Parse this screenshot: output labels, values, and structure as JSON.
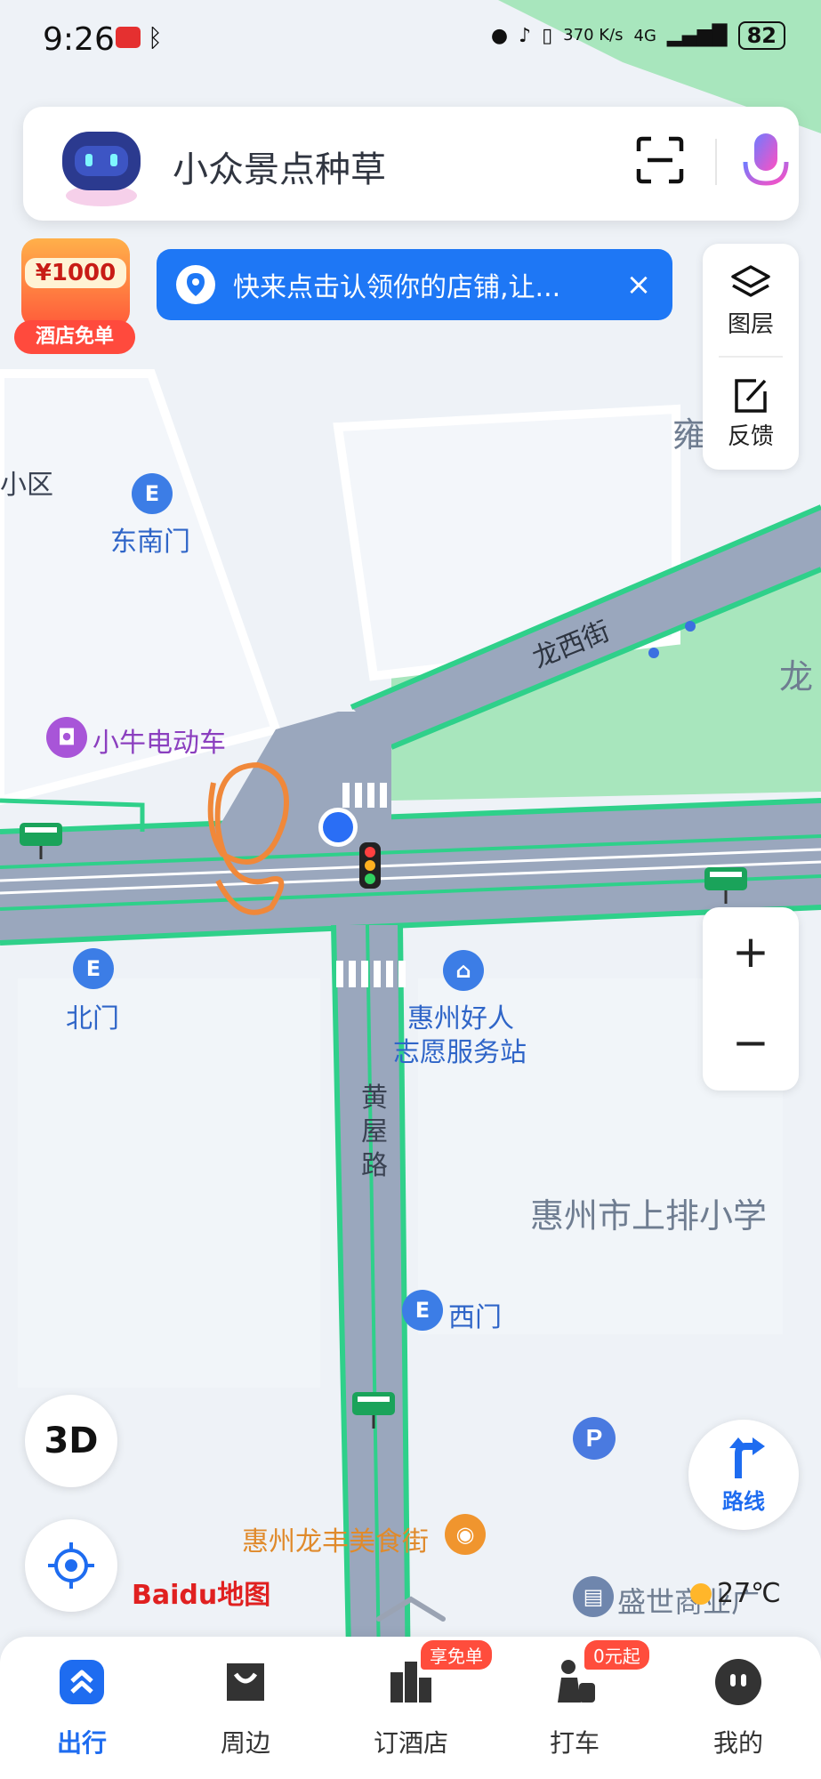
{
  "status_bar": {
    "time": "9:26",
    "network_speed": "370 K/s",
    "network_type": "4G",
    "battery": "82"
  },
  "search": {
    "placeholder": "小众景点种草"
  },
  "promo": {
    "amount": "¥1000",
    "tag": "酒店免单"
  },
  "notice": {
    "message": "快来点击认领你的店铺,让...",
    "close": "×"
  },
  "tools": {
    "layers_label": "图层",
    "feedback_label": "反馈"
  },
  "zoom": {
    "in": "+",
    "out": "−"
  },
  "map": {
    "labels": {
      "xiaoqu": "小区",
      "southeast_gate": "东南门",
      "longxi_street": "龙西街",
      "longxi_partial": "龙",
      "yong_partial": "雍",
      "xiaoniu": "小牛电动车",
      "north_gate": "北门",
      "volunteer_line1": "惠州好人",
      "volunteer_line2": "志愿服务站",
      "huangwu_road": "黄屋路",
      "school": "惠州市上排小学",
      "west_gate": "西门",
      "food_street": "惠州龙丰美食街",
      "shengshi": "盛世商业广"
    }
  },
  "controls": {
    "btn_3d": "3D",
    "route": "路线"
  },
  "logo": {
    "text": "Baidu地图"
  },
  "weather": {
    "temp": "27℃"
  },
  "nav": {
    "items": [
      {
        "label": "出行",
        "badge": ""
      },
      {
        "label": "周边",
        "badge": ""
      },
      {
        "label": "订酒店",
        "badge": "享免单"
      },
      {
        "label": "打车",
        "badge": "0元起"
      },
      {
        "label": "我的",
        "badge": ""
      }
    ]
  },
  "colors": {
    "accent": "#1e6cf0",
    "road": "#9aa7bd",
    "road_edge": "#2fd08a",
    "park": "#a8e6bd",
    "badge": "#ff4d3c"
  }
}
